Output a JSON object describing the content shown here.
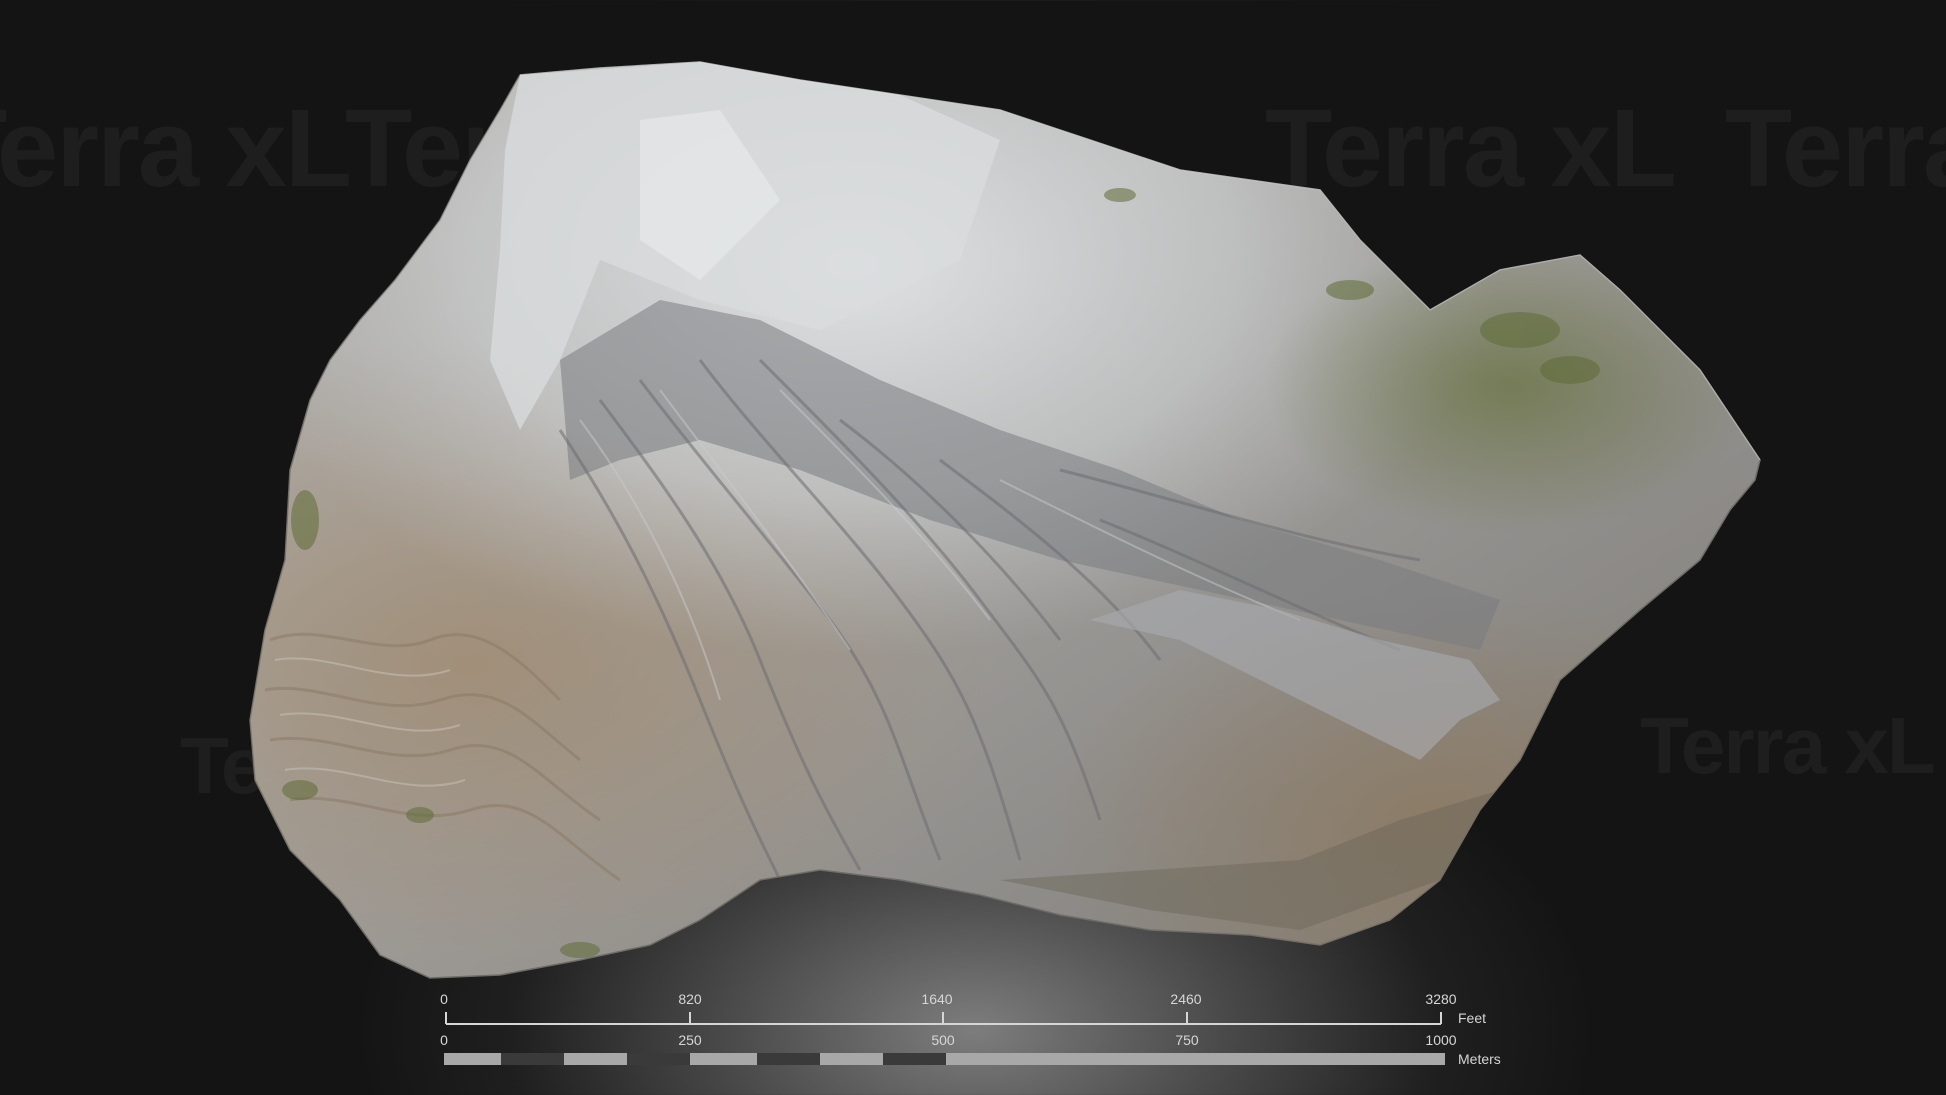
{
  "watermark": {
    "text": "Terra xL"
  },
  "model": {
    "name": "rock-outcrop-3d-model"
  },
  "scale": {
    "feet": {
      "ticks": [
        "0",
        "820",
        "1640",
        "2460",
        "3280"
      ],
      "unit": "Feet"
    },
    "meters": {
      "ticks": [
        "0",
        "250",
        "500",
        "750",
        "1000"
      ],
      "unit": "Meters"
    }
  },
  "colors": {
    "background": "#141414",
    "scale_text": "#d6d6d6",
    "scale_dark": "#3a3a3a",
    "scale_light": "#a8a8a8",
    "rock_light": "#d3d6d8",
    "rock_mid": "#9a9a9c",
    "rock_tan": "#9a8a78",
    "moss": "#5e6a3a"
  }
}
